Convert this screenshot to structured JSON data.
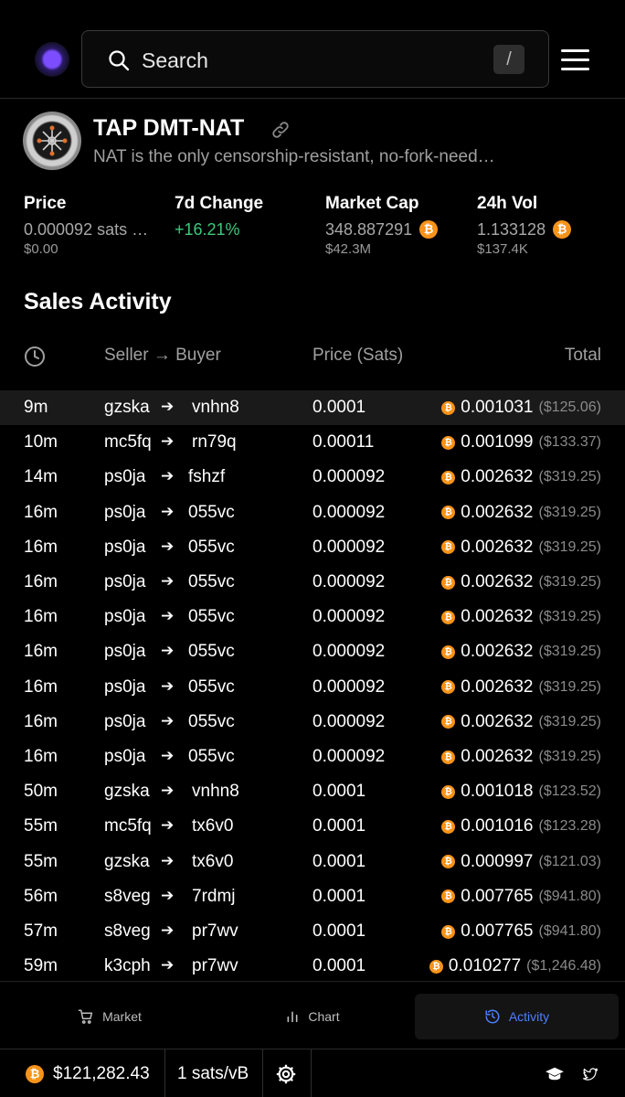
{
  "search": {
    "placeholder": "Search",
    "shortcut": "/"
  },
  "token": {
    "name": "TAP DMT-NAT",
    "description": "NAT is the only censorship-resistant, no-fork-need…"
  },
  "stats": {
    "price": {
      "label": "Price",
      "value": "0.000092 sats …",
      "sub": "$0.00"
    },
    "change7d": {
      "label": "7d Change",
      "value": "+16.21%"
    },
    "market_cap": {
      "label": "Market Cap",
      "value": "348.887291",
      "sub": "$42.3M"
    },
    "vol24h": {
      "label": "24h Vol",
      "value": "1.133128",
      "sub": "$137.4K"
    }
  },
  "sales": {
    "title": "Sales Activity",
    "columns": {
      "seller_buyer": "Seller → Buyer",
      "price": "Price (Sats)",
      "total": "Total"
    },
    "rows": [
      {
        "time": "9m",
        "seller": "gzska",
        "buyer": "vnhn8",
        "price": "0.0001",
        "total": "0.001031",
        "usd": "($125.06)"
      },
      {
        "time": "10m",
        "seller": "mc5fq",
        "buyer": "rn79q",
        "price": "0.00011",
        "total": "0.001099",
        "usd": "($133.37)"
      },
      {
        "time": "14m",
        "seller": "ps0ja",
        "buyer": "fshzf",
        "price": "0.000092",
        "total": "0.002632",
        "usd": "($319.25)"
      },
      {
        "time": "16m",
        "seller": "ps0ja",
        "buyer": "055vc",
        "price": "0.000092",
        "total": "0.002632",
        "usd": "($319.25)"
      },
      {
        "time": "16m",
        "seller": "ps0ja",
        "buyer": "055vc",
        "price": "0.000092",
        "total": "0.002632",
        "usd": "($319.25)"
      },
      {
        "time": "16m",
        "seller": "ps0ja",
        "buyer": "055vc",
        "price": "0.000092",
        "total": "0.002632",
        "usd": "($319.25)"
      },
      {
        "time": "16m",
        "seller": "ps0ja",
        "buyer": "055vc",
        "price": "0.000092",
        "total": "0.002632",
        "usd": "($319.25)"
      },
      {
        "time": "16m",
        "seller": "ps0ja",
        "buyer": "055vc",
        "price": "0.000092",
        "total": "0.002632",
        "usd": "($319.25)"
      },
      {
        "time": "16m",
        "seller": "ps0ja",
        "buyer": "055vc",
        "price": "0.000092",
        "total": "0.002632",
        "usd": "($319.25)"
      },
      {
        "time": "16m",
        "seller": "ps0ja",
        "buyer": "055vc",
        "price": "0.000092",
        "total": "0.002632",
        "usd": "($319.25)"
      },
      {
        "time": "16m",
        "seller": "ps0ja",
        "buyer": "055vc",
        "price": "0.000092",
        "total": "0.002632",
        "usd": "($319.25)"
      },
      {
        "time": "50m",
        "seller": "gzska",
        "buyer": "vnhn8",
        "price": "0.0001",
        "total": "0.001018",
        "usd": "($123.52)"
      },
      {
        "time": "55m",
        "seller": "mc5fq",
        "buyer": "tx6v0",
        "price": "0.0001",
        "total": "0.001016",
        "usd": "($123.28)"
      },
      {
        "time": "55m",
        "seller": "gzska",
        "buyer": "tx6v0",
        "price": "0.0001",
        "total": "0.000997",
        "usd": "($121.03)"
      },
      {
        "time": "56m",
        "seller": "s8veg",
        "buyer": "7rdmj",
        "price": "0.0001",
        "total": "0.007765",
        "usd": "($941.80)"
      },
      {
        "time": "57m",
        "seller": "s8veg",
        "buyer": "pr7wv",
        "price": "0.0001",
        "total": "0.007765",
        "usd": "($941.80)"
      },
      {
        "time": "59m",
        "seller": "k3cph",
        "buyer": "pr7wv",
        "price": "0.0001",
        "total": "0.010277",
        "usd": "($1,246.48)"
      }
    ]
  },
  "nav": {
    "market": "Market",
    "chart": "Chart",
    "activity": "Activity"
  },
  "footer": {
    "btc_price": "$121,282.43",
    "fee_rate": "1 sats/vB"
  },
  "colors": {
    "accent": "#4c7fff",
    "positive": "#3ec97a",
    "bitcoin": "#f7931a"
  }
}
